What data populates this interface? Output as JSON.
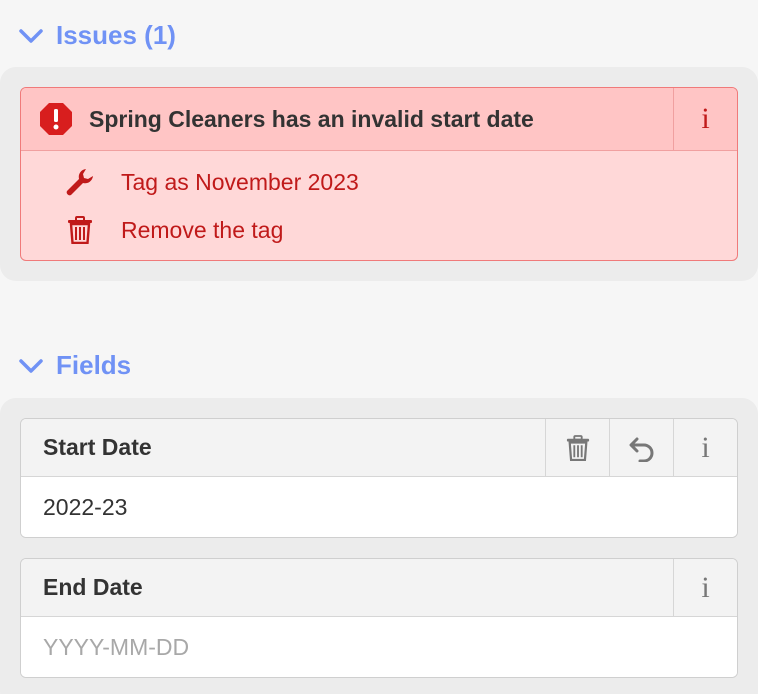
{
  "colors": {
    "accent": "#7092f5",
    "error_text": "#c01a1a",
    "error_bg": "#ffd8d8",
    "error_head_bg": "#ffc5c5",
    "error_border": "#f07a7a",
    "icon_gray": "#777777"
  },
  "issues": {
    "header": "Issues (1)",
    "items": [
      {
        "title": "Spring Cleaners has an invalid start date",
        "status_icon": "alert-octagon-icon",
        "info_icon": "info-icon",
        "info_glyph": "i",
        "actions": [
          {
            "icon": "wrench-icon",
            "label": "Tag as November 2023"
          },
          {
            "icon": "trash-icon",
            "label": "Remove the tag"
          }
        ]
      }
    ]
  },
  "fields": {
    "header": "Fields",
    "items": [
      {
        "label": "Start Date",
        "value": "2022-23",
        "placeholder": "YYYY-MM-DD",
        "buttons": [
          "trash-icon",
          "undo-icon",
          "info-icon"
        ],
        "info_glyph": "i"
      },
      {
        "label": "End Date",
        "value": "",
        "placeholder": "YYYY-MM-DD",
        "buttons": [
          "info-icon"
        ],
        "info_glyph": "i"
      }
    ]
  }
}
